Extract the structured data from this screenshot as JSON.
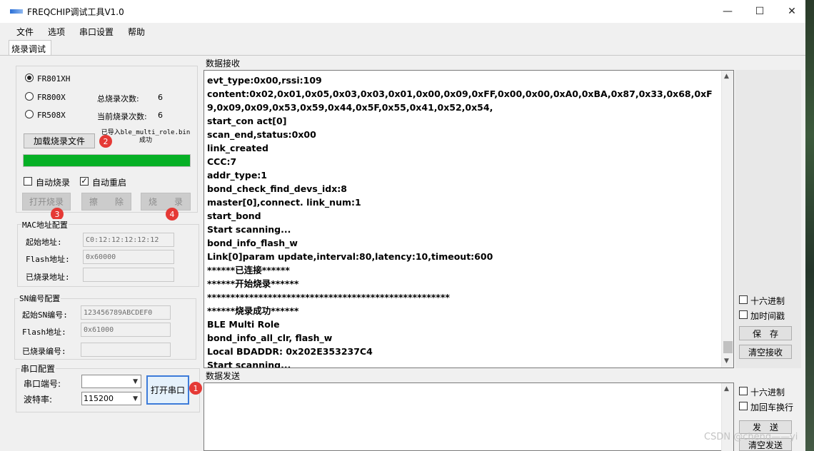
{
  "window": {
    "title": "FREQCHIP调试工具V1.0",
    "minimize_glyph": "—",
    "maximize_glyph": "☐",
    "close_glyph": "✕"
  },
  "menu": {
    "items": [
      "文件",
      "选项",
      "串口设置",
      "帮助"
    ]
  },
  "tabs": [
    {
      "label": "烧录调试",
      "active": true
    }
  ],
  "burn": {
    "chips": [
      {
        "label": "FR801XH",
        "selected": true
      },
      {
        "label": "FR800X",
        "selected": false
      },
      {
        "label": "FR508X",
        "selected": false
      }
    ],
    "total_label": "总烧录次数:",
    "total_value": "6",
    "current_label": "当前烧录次数:",
    "current_value": "6",
    "load_button": "加载烧录文件",
    "load_status_line1": "已导入ble_multi_role.bin",
    "load_status_line2": "成功",
    "progress": 1.0,
    "progress_color": "#06b025",
    "auto_burn_label": "自动烧录",
    "auto_burn_checked": false,
    "auto_restart_label": "自动重启",
    "auto_restart_checked": true,
    "open_burn_button": "打开烧录",
    "erase_button": "擦　　除",
    "burn_button": "烧　　录"
  },
  "badges": [
    "1",
    "2",
    "3",
    "4"
  ],
  "mac": {
    "title": "MAC地址配置",
    "start_label": "起始地址:",
    "start_value": "C0:12:12:12:12:12",
    "flash_label": "Flash地址:",
    "flash_value": "0x60000",
    "burned_label": "已烧录地址:",
    "burned_value": ""
  },
  "sn": {
    "title": "SN编号配置",
    "start_label": "起始SN编号:",
    "start_value": "123456789ABCDEF0",
    "flash_label": "Flash地址:",
    "flash_value": "0x61000",
    "burned_label": "已烧录编号:",
    "burned_value": ""
  },
  "serial": {
    "title": "串口配置",
    "port_label": "串口端号:",
    "port_value": "",
    "baud_label": "波特率:",
    "baud_value": "115200",
    "open_button": "打开串口"
  },
  "receive": {
    "title": "数据接收",
    "lines": [
      "evt_type:0x00,rssi:109",
      "content:0x02,0x01,0x05,0x03,0x03,0x01,0x00,0x09,0xFF,0x00,0x00,0xA0,0xBA,0x87,0x33,0x68,0xF9,0x09,0x09,0x53,0x59,0x44,0x5F,0x55,0x41,0x52,0x54,",
      "start_con act[0]",
      "scan_end,status:0x00",
      "link_created",
      "CCC:7",
      "addr_type:1",
      "bond_check_find_devs_idx:8",
      "master[0],connect. link_num:1",
      "start_bond",
      "Start scanning...",
      "bond_info_flash_w",
      "Link[0]param update,interval:80,latency:10,timeout:600",
      "******已连接******",
      "******开始烧录******",
      "****************************************************",
      "******烧录成功******",
      "BLE Multi Role",
      "bond_info_all_clr, flash_w",
      "Local BDADDR: 0x202E353237C4",
      "Start scanning..."
    ],
    "hex_label": "十六进制",
    "hex_checked": false,
    "timestamp_label": "加时间戳",
    "timestamp_checked": false,
    "save_button": "保　存",
    "clear_button": "清空接收"
  },
  "send": {
    "title": "数据发送",
    "value": "",
    "hex_label": "十六进制",
    "hex_checked": false,
    "crlf_label": "加回车换行",
    "crlf_checked": false,
    "send_button": "发　送",
    "clear_button": "清空发送"
  },
  "watermark": "CSDN @cheng——yi"
}
